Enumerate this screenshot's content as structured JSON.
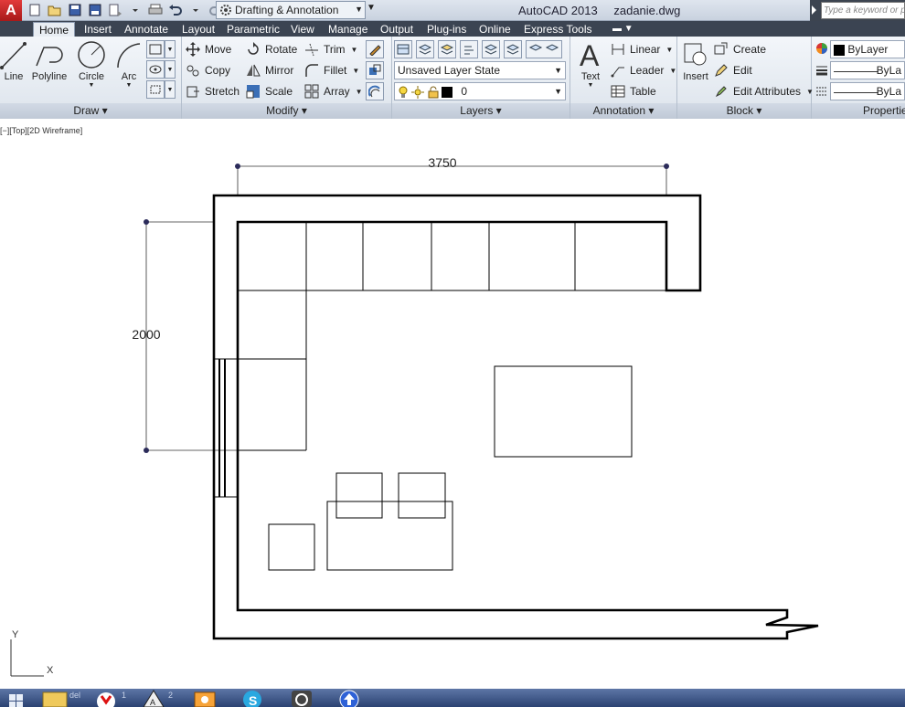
{
  "app": {
    "name": "AutoCAD 2013",
    "file": "zadanie.dwg",
    "app_button": "A"
  },
  "workspace": {
    "selected": "Drafting & Annotation"
  },
  "search": {
    "placeholder": "Type a keyword or p"
  },
  "tabs": [
    {
      "label": "Home",
      "active": true
    },
    {
      "label": "Insert"
    },
    {
      "label": "Annotate"
    },
    {
      "label": "Layout"
    },
    {
      "label": "Parametric"
    },
    {
      "label": "View"
    },
    {
      "label": "Manage"
    },
    {
      "label": "Output"
    },
    {
      "label": "Plug-ins"
    },
    {
      "label": "Online"
    },
    {
      "label": "Express Tools"
    }
  ],
  "ribbon": {
    "draw": {
      "title": "Draw",
      "line": "Line",
      "polyline": "Polyline",
      "circle": "Circle",
      "arc": "Arc"
    },
    "modify": {
      "title": "Modify",
      "move": "Move",
      "rotate": "Rotate",
      "trim": "Trim",
      "copy": "Copy",
      "mirror": "Mirror",
      "fillet": "Fillet",
      "stretch": "Stretch",
      "scale": "Scale",
      "array": "Array"
    },
    "layers": {
      "title": "Layers",
      "layer_state": "Unsaved Layer State",
      "current_layer": "0"
    },
    "annotation": {
      "title": "Annotation",
      "text": "Text",
      "linear": "Linear",
      "leader": "Leader",
      "table": "Table"
    },
    "block": {
      "title": "Block",
      "insert": "Insert",
      "create": "Create",
      "edit": "Edit",
      "edit_attributes": "Edit Attributes"
    },
    "properties": {
      "title": "Properties",
      "color": "ByLayer",
      "linetype": "ByLa",
      "lineweight": "ByLa"
    }
  },
  "viewport": {
    "label": "[−][Top][2D Wireframe]"
  },
  "drawing": {
    "dim_horizontal": "3750",
    "dim_vertical": "2000",
    "ucs_y": "Y",
    "ucs_x": "X"
  },
  "taskbar": {
    "items": [
      "windows-start",
      "folder",
      "yandex-browser",
      "autocad",
      "paint",
      "skype",
      "search-app",
      "upload"
    ],
    "labels": [
      "del",
      "1",
      "2"
    ]
  },
  "colors": {
    "title_bar": "#c9d2df",
    "tab_bar": "#3b4452",
    "ribbon": "#dde4ec",
    "app_button": "#c21f1f",
    "taskbar": "#3a5387"
  }
}
